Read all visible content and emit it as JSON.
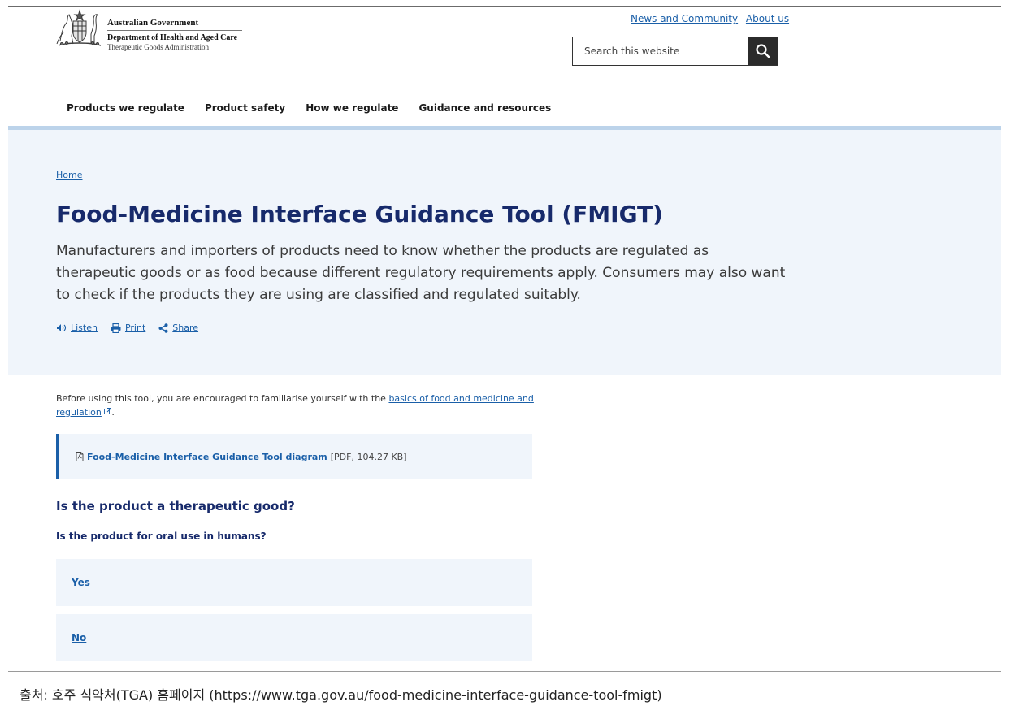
{
  "header": {
    "gov_name": "Australian Government",
    "department": "Department of Health and Aged Care",
    "agency": "Therapeutic Goods Administration",
    "crest_icon": "australian-coat-of-arms-icon",
    "top_links": [
      "News and Community",
      "About us"
    ],
    "search": {
      "placeholder": "Search this website",
      "value": ""
    },
    "search_icon": "search-icon"
  },
  "nav": {
    "items": [
      "Products we regulate",
      "Product safety",
      "How we regulate",
      "Guidance and resources"
    ]
  },
  "hero": {
    "breadcrumb": "Home",
    "title": "Food-Medicine Interface Guidance Tool (FMIGT)",
    "intro": "Manufacturers and importers of products need to know whether the products are regulated as therapeutic goods or as food because different regulatory requirements apply. Consumers may also want to check if the products they are using are classified and regulated suitably.",
    "actions": [
      {
        "label": "Listen",
        "icon": "speaker-icon"
      },
      {
        "label": "Print",
        "icon": "printer-icon"
      },
      {
        "label": "Share",
        "icon": "share-icon"
      }
    ]
  },
  "content": {
    "intro_prefix": "Before using this tool, you are encouraged to familiarise yourself with the",
    "intro_link": "basics of food and medicine and regulation",
    "intro_suffix": ".",
    "external_icon": "external-link-icon",
    "document": {
      "icon": "pdf-file-icon",
      "link": "Food-Medicine Interface Guidance Tool diagram",
      "meta": "[PDF, 104.27 KB]"
    },
    "question_heading": "Is the product a therapeutic good?",
    "question_sub": "Is the product for oral use in humans?",
    "answers": [
      "Yes",
      "No"
    ]
  },
  "caption": "출처: 호주 식약처(TGA) 홈페이지 (https://www.tga.gov.au/food-medicine-interface-guidance-tool-fmigt)",
  "colors": {
    "accent": "#172a6b",
    "link": "#1a5fa8",
    "panel": "#f0f5fb",
    "nav_rule": "#bcd3ea"
  }
}
